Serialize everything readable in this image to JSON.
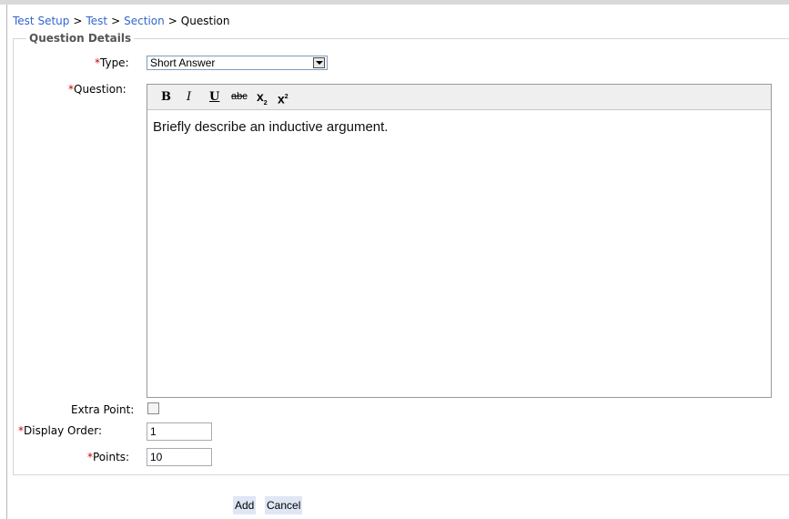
{
  "breadcrumb": {
    "items": [
      "Test Setup",
      "Test",
      "Section"
    ],
    "current": "Question",
    "separator": ">"
  },
  "section": {
    "legend": "Question Details"
  },
  "fields": {
    "required_marker": "*",
    "type": {
      "label": "Type:",
      "value": "Short Answer"
    },
    "question": {
      "label": "Question:",
      "toolbar": {
        "bold": "B",
        "italic": "I",
        "underline": "U",
        "strike": "abc",
        "subscript": "x",
        "subscript_mark": "2",
        "superscript": "x",
        "superscript_mark": "2"
      },
      "content": "Briefly describe an inductive argument."
    },
    "extra_point": {
      "label": "Extra Point:",
      "checked": false
    },
    "display_order": {
      "label": "Display Order:",
      "value": "1"
    },
    "points": {
      "label": "Points:",
      "value": "10"
    }
  },
  "actions": {
    "add": "Add",
    "cancel": "Cancel"
  },
  "colors": {
    "link": "#3366cc",
    "required": "#cc0000",
    "button_bg": "#dfe6f4"
  }
}
